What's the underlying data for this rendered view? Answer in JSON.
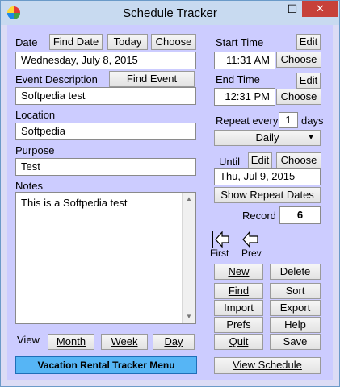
{
  "window": {
    "title": "Schedule Tracker",
    "minimize": "—",
    "maximize": "☐",
    "close": "✕"
  },
  "date": {
    "label": "Date",
    "find_date": "Find Date",
    "today": "Today",
    "choose": "Choose",
    "value": "Wednesday, July 8, 2015"
  },
  "event": {
    "label": "Event Description",
    "find_event": "Find Event",
    "value": "Softpedia test"
  },
  "location": {
    "label": "Location",
    "value": "Softpedia"
  },
  "purpose": {
    "label": "Purpose",
    "value": "Test"
  },
  "notes": {
    "label": "Notes",
    "value": "This is a Softpedia test"
  },
  "view": {
    "label": "View",
    "month": "Month",
    "week": "Week",
    "day": "Day"
  },
  "menu_button": "Vacation Rental Tracker Menu",
  "start": {
    "label": "Start Time",
    "edit": "Edit",
    "value": "11:31 AM",
    "choose": "Choose"
  },
  "end": {
    "label": "End Time",
    "edit": "Edit",
    "value": "12:31 PM",
    "choose": "Choose"
  },
  "repeat": {
    "label": "Repeat every",
    "count": "1",
    "unit": "days",
    "frequency": "Daily"
  },
  "until": {
    "label": "Until",
    "edit": "Edit",
    "choose": "Choose",
    "value": "Thu, Jul 9, 2015",
    "show_repeat": "Show Repeat Dates"
  },
  "record": {
    "label": "Record #",
    "value": "6"
  },
  "nav": {
    "first": "First",
    "prev": "Prev"
  },
  "actions": {
    "new": "New",
    "delete": "Delete",
    "find": "Find",
    "sort": "Sort",
    "import": "Import",
    "export": "Export",
    "prefs": "Prefs",
    "help": "Help",
    "quit": "Quit",
    "save": "Save",
    "view_schedule": "View Schedule"
  }
}
